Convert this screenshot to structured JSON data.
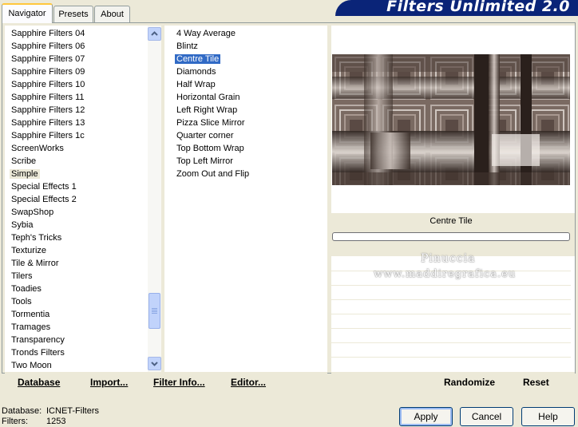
{
  "tabs": [
    "Navigator",
    "Presets",
    "About"
  ],
  "banner_title": "Filters Unlimited 2.0",
  "categories": [
    "Sapphire Filters 04",
    "Sapphire Filters 06",
    "Sapphire Filters 07",
    "Sapphire Filters 09",
    "Sapphire Filters 10",
    "Sapphire Filters 11",
    "Sapphire Filters 12",
    "Sapphire Filters 13",
    "Sapphire Filters 1c",
    "ScreenWorks",
    "Scribe",
    "Simple",
    "Special Effects 1",
    "Special Effects 2",
    "SwapShop",
    "Sybia",
    "Teph's Tricks",
    "Texturize",
    "Tile & Mirror",
    "Tilers",
    "Toadies",
    "Tools",
    "Tormentia",
    "Tramages",
    "Transparency",
    "Tronds Filters",
    "Two Moon"
  ],
  "selected_category": "Simple",
  "filters": [
    "4 Way Average",
    "Blintz",
    "Centre Tile",
    "Diamonds",
    "Half Wrap",
    "Horizontal Grain",
    "Left Right Wrap",
    "Pizza Slice Mirror",
    "Quarter corner",
    "Top Bottom Wrap",
    "Top Left Mirror",
    "Zoom Out and Flip"
  ],
  "selected_filter": "Centre Tile",
  "preview": {
    "filter_name": "Centre Tile",
    "watermark_line1": "Pinuccia",
    "watermark_line2": "www.maddiregrafica.eu"
  },
  "links": {
    "database": "Database",
    "import": "Import...",
    "filter_info": "Filter Info...",
    "editor": "Editor...",
    "randomize": "Randomize",
    "reset": "Reset"
  },
  "buttons": {
    "apply": "Apply",
    "cancel": "Cancel",
    "help": "Help"
  },
  "status": {
    "database_label": "Database:",
    "database_value": "ICNET-Filters",
    "filters_label": "Filters:",
    "filters_value": "1253"
  },
  "colors": {
    "banner": "#0a2478",
    "selection": "#316ac5",
    "window": "#ece9d8"
  }
}
